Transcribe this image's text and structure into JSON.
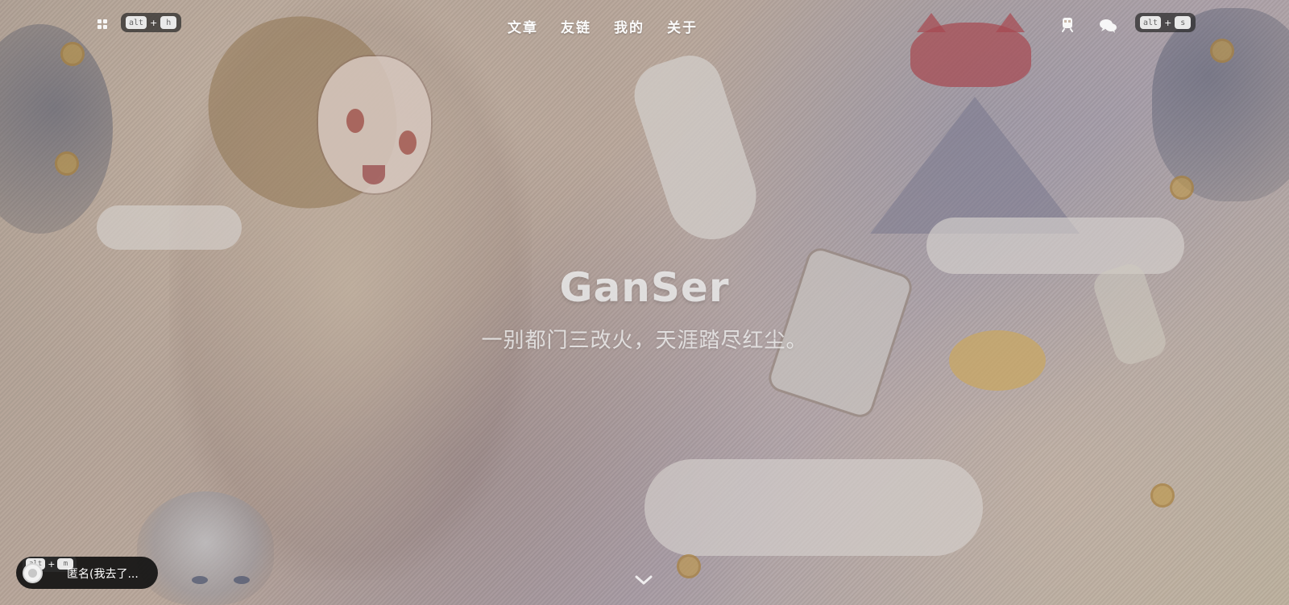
{
  "header": {
    "left_shortcut": {
      "alt": "alt",
      "plus": "+",
      "key": "h"
    },
    "nav": [
      {
        "label": "文章"
      },
      {
        "label": "友链"
      },
      {
        "label": "我的"
      },
      {
        "label": "关于"
      }
    ],
    "right_shortcut": {
      "alt": "alt",
      "plus": "+",
      "key": "s"
    }
  },
  "hero": {
    "title": "GanSer",
    "subtitle": "一别都门三改火，天涯踏尽红尘。"
  },
  "player": {
    "shortcut": {
      "alt": "alt",
      "plus": "+",
      "key": "m"
    },
    "song": "匿名(我去了..."
  },
  "icons": {
    "menu": "menu-icon",
    "train": "train-icon",
    "chat": "chat-icon",
    "scroll": "chevron-down-icon",
    "avatar": "avatar-icon"
  }
}
